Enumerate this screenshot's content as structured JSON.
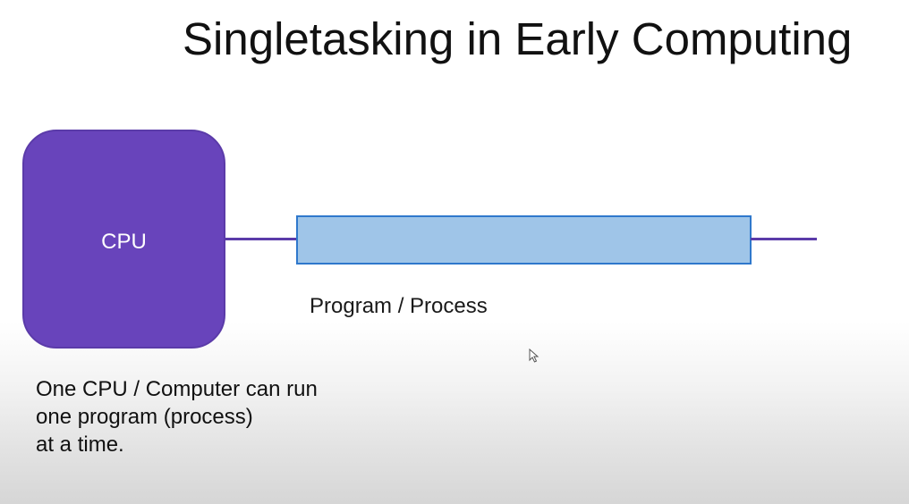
{
  "slide": {
    "title": "Singletasking in Early Computing"
  },
  "diagram": {
    "cpu_label": "CPU",
    "process_label": "Program / Process",
    "cpu_color": "#6844bb",
    "process_color": "#9fc5e8",
    "process_border_color": "#2f78cc",
    "wire_color": "#5b3ba9"
  },
  "caption": {
    "lines": [
      "One CPU / Computer can run",
      "one program (process)",
      "at a time."
    ]
  },
  "cursor": {
    "icon": "mouse-pointer-icon"
  }
}
